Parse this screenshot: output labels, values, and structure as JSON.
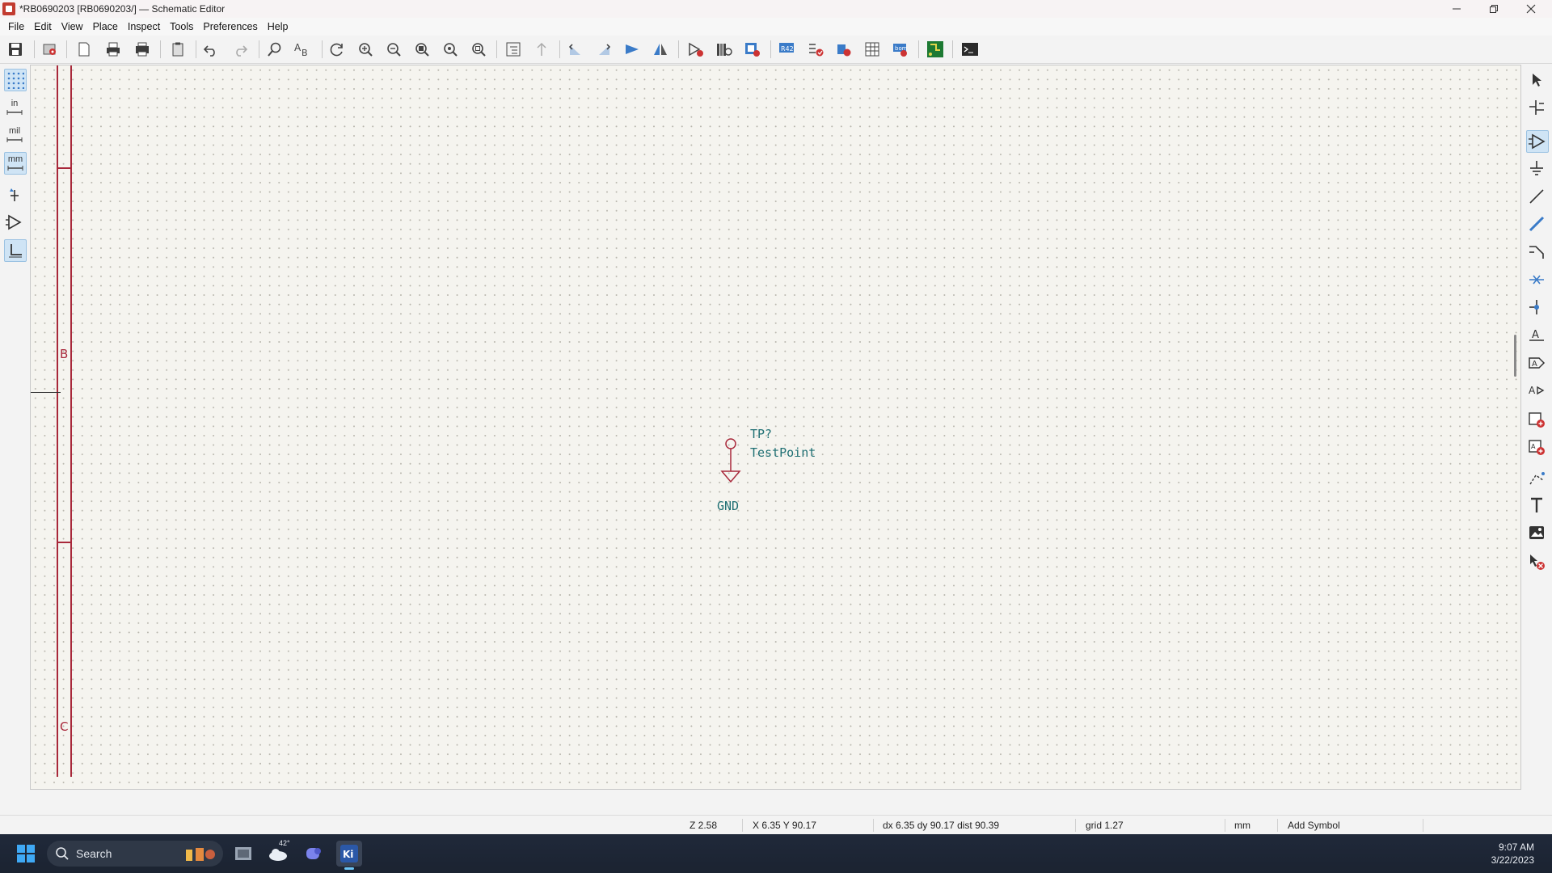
{
  "window": {
    "title": "*RB0690203 [RB0690203/] — Schematic Editor",
    "controls": [
      "minimize",
      "restore",
      "close"
    ]
  },
  "menubar": {
    "items": [
      "File",
      "Edit",
      "View",
      "Place",
      "Inspect",
      "Tools",
      "Preferences",
      "Help"
    ]
  },
  "toolbar": {
    "buttons": [
      "save-icon",
      "schematic-setup-icon",
      "page-settings-icon",
      "print-icon",
      "plot-icon",
      "paste-icon",
      "undo-icon",
      "redo-icon",
      "find-icon",
      "find-replace-icon",
      "refresh-icon",
      "zoom-in-icon",
      "zoom-out-icon",
      "zoom-fit-icon",
      "zoom-objects-icon",
      "zoom-selection-icon",
      "hierarchy-navigator-icon",
      "leave-sheet-icon",
      "rotate-ccw-icon",
      "rotate-cw-icon",
      "mirror-v-icon",
      "mirror-h-icon",
      "symbol-editor-icon",
      "symbol-browser-icon",
      "annotate-icon",
      "erc-icon",
      "footprint-assign-icon",
      "bom-icon",
      "netlist-icon",
      "fields-editor-icon",
      "board-icon",
      "pcb-editor-icon",
      "scripting-console-icon"
    ]
  },
  "left_toolbar": {
    "grid_toggle": "grid-icon",
    "unit_in": "in",
    "unit_mil": "mil",
    "unit_mm": "mm",
    "cursor_toggle": "cursor-icon",
    "hidden_pins": "hidden-pins-icon",
    "line_mode": "line-mode-icon"
  },
  "right_toolbar": {
    "tools": [
      "select-icon",
      "highlight-net-icon",
      "add-symbol-icon",
      "add-power-icon",
      "add-wire-icon",
      "add-bus-icon",
      "bus-entry-icon",
      "no-connect-icon",
      "junction-icon",
      "label-icon",
      "global-label-icon",
      "hier-label-icon",
      "hier-sheet-icon",
      "import-sheet-pin-icon",
      "graphic-line-icon",
      "text-icon",
      "image-icon",
      "delete-icon"
    ]
  },
  "canvas": {
    "frame_rows": [
      "B",
      "C"
    ],
    "symbol": {
      "reference": "TP?",
      "value": "TestPoint",
      "power_label": "GND"
    }
  },
  "statusbar": {
    "zoom": "Z 2.58",
    "cursor": "X 6.35  Y 90.17",
    "delta": "dx 6.35  dy 90.17  dist 90.39",
    "grid": "grid 1.27",
    "units": "mm",
    "action": "Add Symbol"
  },
  "taskbar": {
    "search_placeholder": "Search",
    "weather": "42°",
    "time": "9:07 AM",
    "date": "3/22/2023",
    "apps": [
      "start-icon",
      "search-icon",
      "file-explorer-icon",
      "weather-icon",
      "teams-icon",
      "kicad-icon"
    ]
  },
  "colors": {
    "frame": "#a8283a",
    "symbol": "#1f6f73",
    "canvas_bg": "#f5f4ef",
    "accent": "#3a7bc8"
  }
}
